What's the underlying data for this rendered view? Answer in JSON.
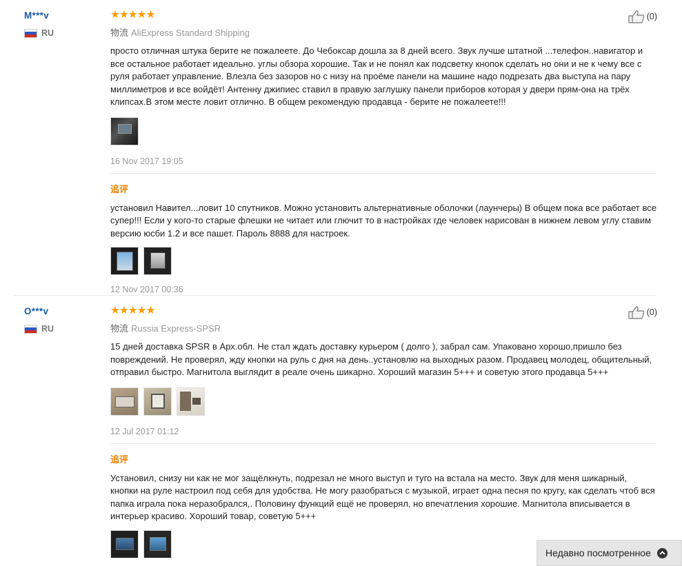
{
  "reviews": [
    {
      "username": "M***v",
      "country": "RU",
      "stars": "★★★★★",
      "shipping_label": "物流",
      "shipping": "AliExpress Standard Shipping",
      "likes": "(0)",
      "text": "просто отличная штука берите не пожалеете. До Чебоксар дошла за 8 дней всего. Звук лучше штатной ...телефон..навигатор и все остальное работает идеально. углы обзора хорошие. Так и не понял как подсветку кнопок сделать но они и не к чему все с руля работает управление. Влезла без зазоров но с низу на проёме панели на машине надо подрезать два выступа на пару миллиметров и все войдёт! Антенну джипиес ставил в правую заглушку панели приборов которая у двери прям-она на трёх клипсах.В этом месте ловит отлично. В общем рекомендую продавца - берите не пожалеете!!!",
      "date": "16 Nov 2017 19:05",
      "additional_label": "追评",
      "additional_text": "установил Навител...ловит 10 спутников. Можно установить альтернативные оболочки (лаунчеры) В общем пока все работает все супер!!! Если у кого-то старые флешки не читает или глючит то в настройках где человек нарисован в нижнем левом углу ставим версию юсби 1.2 и все пашет. Пароль 8888 для настроек.",
      "additional_date": "12 Nov 2017 00:36"
    },
    {
      "username": "O***v",
      "country": "RU",
      "stars": "★★★★★",
      "shipping_label": "物流",
      "shipping": "Russia Express-SPSR",
      "likes": "(0)",
      "text": "15 дней доставка SPSR в Арх.обл. Не стал ждать доставку курьером ( долго ), забрал сам. Упаковано хорошо,пришло без повреждений. Не проверял, жду кнопки на руль с дня на день..установлю на выходных разом. Продавец молодец, общительный, отправил быстро. Магнитола выглядит в реале очень шикарно. Хороший магазин 5+++ и советую этого продавца 5+++",
      "date": "12 Jul 2017 01:12",
      "additional_label": "追评",
      "additional_text": "Установил, снизу ни как не мог защёлкнуть, подрезал не много выступ и туго на встала на место. Звук для меня шикарный, кнопки на руле настроил под себя для удобства. Не могу разобраться с музыкой, играет одна песня по кругу, как сделать чтоб вся папка играла пока неразобрался,. Половину функций ещё не проверял, но впечатления хорошие. Магнитола вписывается в интерьер красиво. Хороший товар, советую 5+++"
    }
  ],
  "recent_viewed": "Недавно посмотренное",
  "colors": {
    "username": "#1a5aa6",
    "star": "#ff9a00",
    "additional_label": "#e8860a"
  },
  "icons": {
    "like": "thumbs-up-icon",
    "collapse": "chevron-up-circle-icon"
  }
}
